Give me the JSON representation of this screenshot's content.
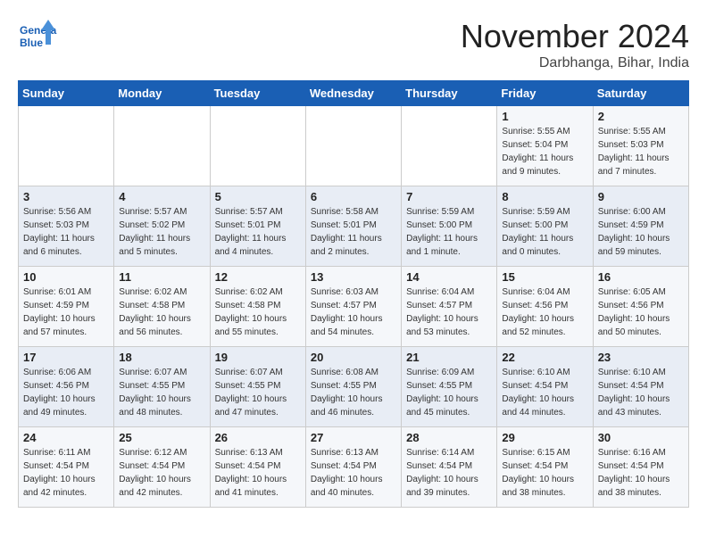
{
  "header": {
    "logo_line1": "General",
    "logo_line2": "Blue",
    "month": "November 2024",
    "location": "Darbhanga, Bihar, India"
  },
  "weekdays": [
    "Sunday",
    "Monday",
    "Tuesday",
    "Wednesday",
    "Thursday",
    "Friday",
    "Saturday"
  ],
  "weeks": [
    [
      {
        "day": "",
        "info": ""
      },
      {
        "day": "",
        "info": ""
      },
      {
        "day": "",
        "info": ""
      },
      {
        "day": "",
        "info": ""
      },
      {
        "day": "",
        "info": ""
      },
      {
        "day": "1",
        "info": "Sunrise: 5:55 AM\nSunset: 5:04 PM\nDaylight: 11 hours\nand 9 minutes."
      },
      {
        "day": "2",
        "info": "Sunrise: 5:55 AM\nSunset: 5:03 PM\nDaylight: 11 hours\nand 7 minutes."
      }
    ],
    [
      {
        "day": "3",
        "info": "Sunrise: 5:56 AM\nSunset: 5:03 PM\nDaylight: 11 hours\nand 6 minutes."
      },
      {
        "day": "4",
        "info": "Sunrise: 5:57 AM\nSunset: 5:02 PM\nDaylight: 11 hours\nand 5 minutes."
      },
      {
        "day": "5",
        "info": "Sunrise: 5:57 AM\nSunset: 5:01 PM\nDaylight: 11 hours\nand 4 minutes."
      },
      {
        "day": "6",
        "info": "Sunrise: 5:58 AM\nSunset: 5:01 PM\nDaylight: 11 hours\nand 2 minutes."
      },
      {
        "day": "7",
        "info": "Sunrise: 5:59 AM\nSunset: 5:00 PM\nDaylight: 11 hours\nand 1 minute."
      },
      {
        "day": "8",
        "info": "Sunrise: 5:59 AM\nSunset: 5:00 PM\nDaylight: 11 hours\nand 0 minutes."
      },
      {
        "day": "9",
        "info": "Sunrise: 6:00 AM\nSunset: 4:59 PM\nDaylight: 10 hours\nand 59 minutes."
      }
    ],
    [
      {
        "day": "10",
        "info": "Sunrise: 6:01 AM\nSunset: 4:59 PM\nDaylight: 10 hours\nand 57 minutes."
      },
      {
        "day": "11",
        "info": "Sunrise: 6:02 AM\nSunset: 4:58 PM\nDaylight: 10 hours\nand 56 minutes."
      },
      {
        "day": "12",
        "info": "Sunrise: 6:02 AM\nSunset: 4:58 PM\nDaylight: 10 hours\nand 55 minutes."
      },
      {
        "day": "13",
        "info": "Sunrise: 6:03 AM\nSunset: 4:57 PM\nDaylight: 10 hours\nand 54 minutes."
      },
      {
        "day": "14",
        "info": "Sunrise: 6:04 AM\nSunset: 4:57 PM\nDaylight: 10 hours\nand 53 minutes."
      },
      {
        "day": "15",
        "info": "Sunrise: 6:04 AM\nSunset: 4:56 PM\nDaylight: 10 hours\nand 52 minutes."
      },
      {
        "day": "16",
        "info": "Sunrise: 6:05 AM\nSunset: 4:56 PM\nDaylight: 10 hours\nand 50 minutes."
      }
    ],
    [
      {
        "day": "17",
        "info": "Sunrise: 6:06 AM\nSunset: 4:56 PM\nDaylight: 10 hours\nand 49 minutes."
      },
      {
        "day": "18",
        "info": "Sunrise: 6:07 AM\nSunset: 4:55 PM\nDaylight: 10 hours\nand 48 minutes."
      },
      {
        "day": "19",
        "info": "Sunrise: 6:07 AM\nSunset: 4:55 PM\nDaylight: 10 hours\nand 47 minutes."
      },
      {
        "day": "20",
        "info": "Sunrise: 6:08 AM\nSunset: 4:55 PM\nDaylight: 10 hours\nand 46 minutes."
      },
      {
        "day": "21",
        "info": "Sunrise: 6:09 AM\nSunset: 4:55 PM\nDaylight: 10 hours\nand 45 minutes."
      },
      {
        "day": "22",
        "info": "Sunrise: 6:10 AM\nSunset: 4:54 PM\nDaylight: 10 hours\nand 44 minutes."
      },
      {
        "day": "23",
        "info": "Sunrise: 6:10 AM\nSunset: 4:54 PM\nDaylight: 10 hours\nand 43 minutes."
      }
    ],
    [
      {
        "day": "24",
        "info": "Sunrise: 6:11 AM\nSunset: 4:54 PM\nDaylight: 10 hours\nand 42 minutes."
      },
      {
        "day": "25",
        "info": "Sunrise: 6:12 AM\nSunset: 4:54 PM\nDaylight: 10 hours\nand 42 minutes."
      },
      {
        "day": "26",
        "info": "Sunrise: 6:13 AM\nSunset: 4:54 PM\nDaylight: 10 hours\nand 41 minutes."
      },
      {
        "day": "27",
        "info": "Sunrise: 6:13 AM\nSunset: 4:54 PM\nDaylight: 10 hours\nand 40 minutes."
      },
      {
        "day": "28",
        "info": "Sunrise: 6:14 AM\nSunset: 4:54 PM\nDaylight: 10 hours\nand 39 minutes."
      },
      {
        "day": "29",
        "info": "Sunrise: 6:15 AM\nSunset: 4:54 PM\nDaylight: 10 hours\nand 38 minutes."
      },
      {
        "day": "30",
        "info": "Sunrise: 6:16 AM\nSunset: 4:54 PM\nDaylight: 10 hours\nand 38 minutes."
      }
    ]
  ]
}
